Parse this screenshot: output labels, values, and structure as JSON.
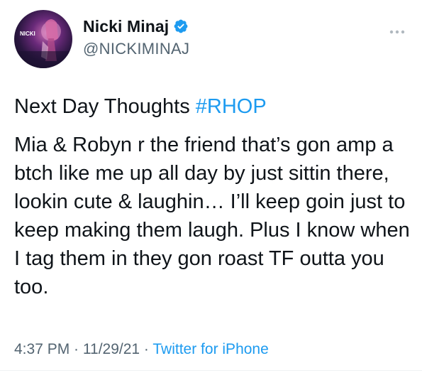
{
  "user": {
    "display_name": "Nicki Minaj",
    "handle": "@NICKIMINAJ",
    "avatar_text": "NICKI"
  },
  "tweet": {
    "intro": "Next Day Thoughts ",
    "hashtag": "#RHOP",
    "body": "Mia & Robyn r the friend that’s gon amp a btch like me up all day by just sittin there, lookin cute & laughin… I’ll keep goin just to keep making them laugh. Plus I know when I tag them in they gon roast TF outta you too."
  },
  "meta": {
    "time": "4:37 PM",
    "separator1": " · ",
    "date": "11/29/21",
    "separator2": " · ",
    "source": "Twitter for iPhone"
  },
  "colors": {
    "link": "#1d9bf0",
    "secondary": "#536471",
    "text": "#0f1419"
  },
  "icons": {
    "verified": "verified-badge-icon",
    "more": "more-options-icon"
  }
}
